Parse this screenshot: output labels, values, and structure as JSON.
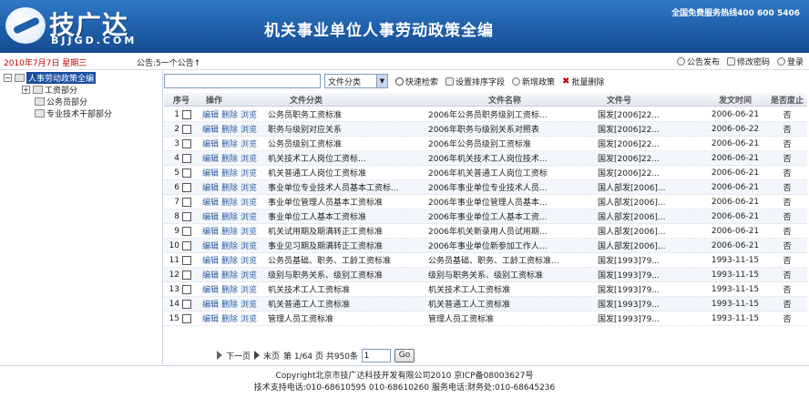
{
  "header": {
    "logo_text": "技广达",
    "logo_sub": "BJJGD.COM",
    "title": "机关事业单位人事劳动政策全编",
    "hotline": "全国免费服务热线400 600 5406"
  },
  "infobar": {
    "date": "2010年7月7日  星期三",
    "notice": "公告:5一个公告↑",
    "actions": [
      {
        "label": "公告发布",
        "icon": "announce-icon"
      },
      {
        "label": "修改密码",
        "icon": "key-icon"
      },
      {
        "label": "登录",
        "icon": "login-icon"
      }
    ]
  },
  "tree": {
    "root": "人事劳动政策全编",
    "items": [
      "工资部分",
      "公务员部分",
      "专业技术干部部分"
    ]
  },
  "toolbar": {
    "search_value": "",
    "select_value": "文件分类",
    "quick_search": "快速检索",
    "sort_fields": "设置排序字段",
    "add_policy": "新增政策",
    "batch_delete": "批量删除"
  },
  "columns": {
    "no": "序号",
    "ops": "操作",
    "category": "文件分类",
    "name": "文件名称",
    "doc_no": "文件号",
    "date": "发文时间",
    "void": "是否废止"
  },
  "ops_labels": {
    "edit": "编辑",
    "delete": "删除",
    "browse": "浏览"
  },
  "rows": [
    {
      "no": "1",
      "category": "公务员职务工资标准",
      "name": "2006年公务员职务级别工资标...",
      "doc_no": "国发[2006]22...",
      "date": "2006-06-21",
      "void": "否"
    },
    {
      "no": "2",
      "category": "职务与级别对应关系",
      "name": "2006年职务与级别关系对照表",
      "doc_no": "国发[2006]22...",
      "date": "2006-06-22",
      "void": "否"
    },
    {
      "no": "3",
      "category": "公务员级别工资标准",
      "name": "2006年公务员级别工资标准",
      "doc_no": "国发[2006]22...",
      "date": "2006-06-21",
      "void": "否"
    },
    {
      "no": "4",
      "category": "机关技术工人岗位工资标...",
      "name": "2006年机关技术工人岗位技术...",
      "doc_no": "国发[2006]22...",
      "date": "2006-06-21",
      "void": "否"
    },
    {
      "no": "5",
      "category": "机关普通工人岗位工资标准",
      "name": "2006年机关普通工人岗位工资标",
      "doc_no": "国发[2006]22...",
      "date": "2006-06-21",
      "void": "否"
    },
    {
      "no": "6",
      "category": "事业单位专业技术人员基本工资标...",
      "name": "2006年事业单位专业技术人员...",
      "doc_no": "国人部发[2006]...",
      "date": "2006-06-21",
      "void": "否"
    },
    {
      "no": "7",
      "category": "事业单位管理人员基本工资标准",
      "name": "2006年事业单位管理人员基本...",
      "doc_no": "国人部发[2006]...",
      "date": "2006-06-21",
      "void": "否"
    },
    {
      "no": "8",
      "category": "事业单位工人基本工资标准",
      "name": "2006年事业单位工人基本工资...",
      "doc_no": "国人部发[2006]...",
      "date": "2006-06-21",
      "void": "否"
    },
    {
      "no": "9",
      "category": "机关试用期及期满转正工资标准",
      "name": "2006年机关新录用人员试用期...",
      "doc_no": "国人部发[2006]...",
      "date": "2006-06-21",
      "void": "否"
    },
    {
      "no": "10",
      "category": "事业见习期及期满转正工资标准",
      "name": "2006年事业单位新参加工作人...",
      "doc_no": "国人部发[2006]...",
      "date": "2006-06-21",
      "void": "否"
    },
    {
      "no": "11",
      "category": "公务员基础、职务、工龄工资标准",
      "name": "公务员基础、职务、工龄工资标准...",
      "doc_no": "国发[1993]79...",
      "date": "1993-11-15",
      "void": "否"
    },
    {
      "no": "12",
      "category": "级别与职务关系、级别工资标准",
      "name": "级别与职务关系、级别工资标准",
      "doc_no": "国发[1993]79...",
      "date": "1993-11-15",
      "void": "否"
    },
    {
      "no": "13",
      "category": "机关技术工人工资标准",
      "name": "机关技术工人工资标准",
      "doc_no": "国发[1993]79...",
      "date": "1993-11-15",
      "void": "否"
    },
    {
      "no": "14",
      "category": "机关普通工人工资标准",
      "name": "机关普通工人工资标准",
      "doc_no": "国发[1993]79...",
      "date": "1993-11-15",
      "void": "否"
    },
    {
      "no": "15",
      "category": "管理人员工资标准",
      "name": "管理人员工资标准",
      "doc_no": "国发[1993]79...",
      "date": "1993-11-15",
      "void": "否"
    }
  ],
  "pager": {
    "next": "下一页",
    "last": "末页",
    "info": "第 1/64 页 共950条",
    "page_value": "1",
    "go": "Go"
  },
  "footer": {
    "line1": "Copyright北京市技广达科技开发有限公司2010  京ICP备08003627号",
    "line2": "技术支持电话:010-68610595 010-68610260     服务电话:财务处:010-68645236"
  }
}
